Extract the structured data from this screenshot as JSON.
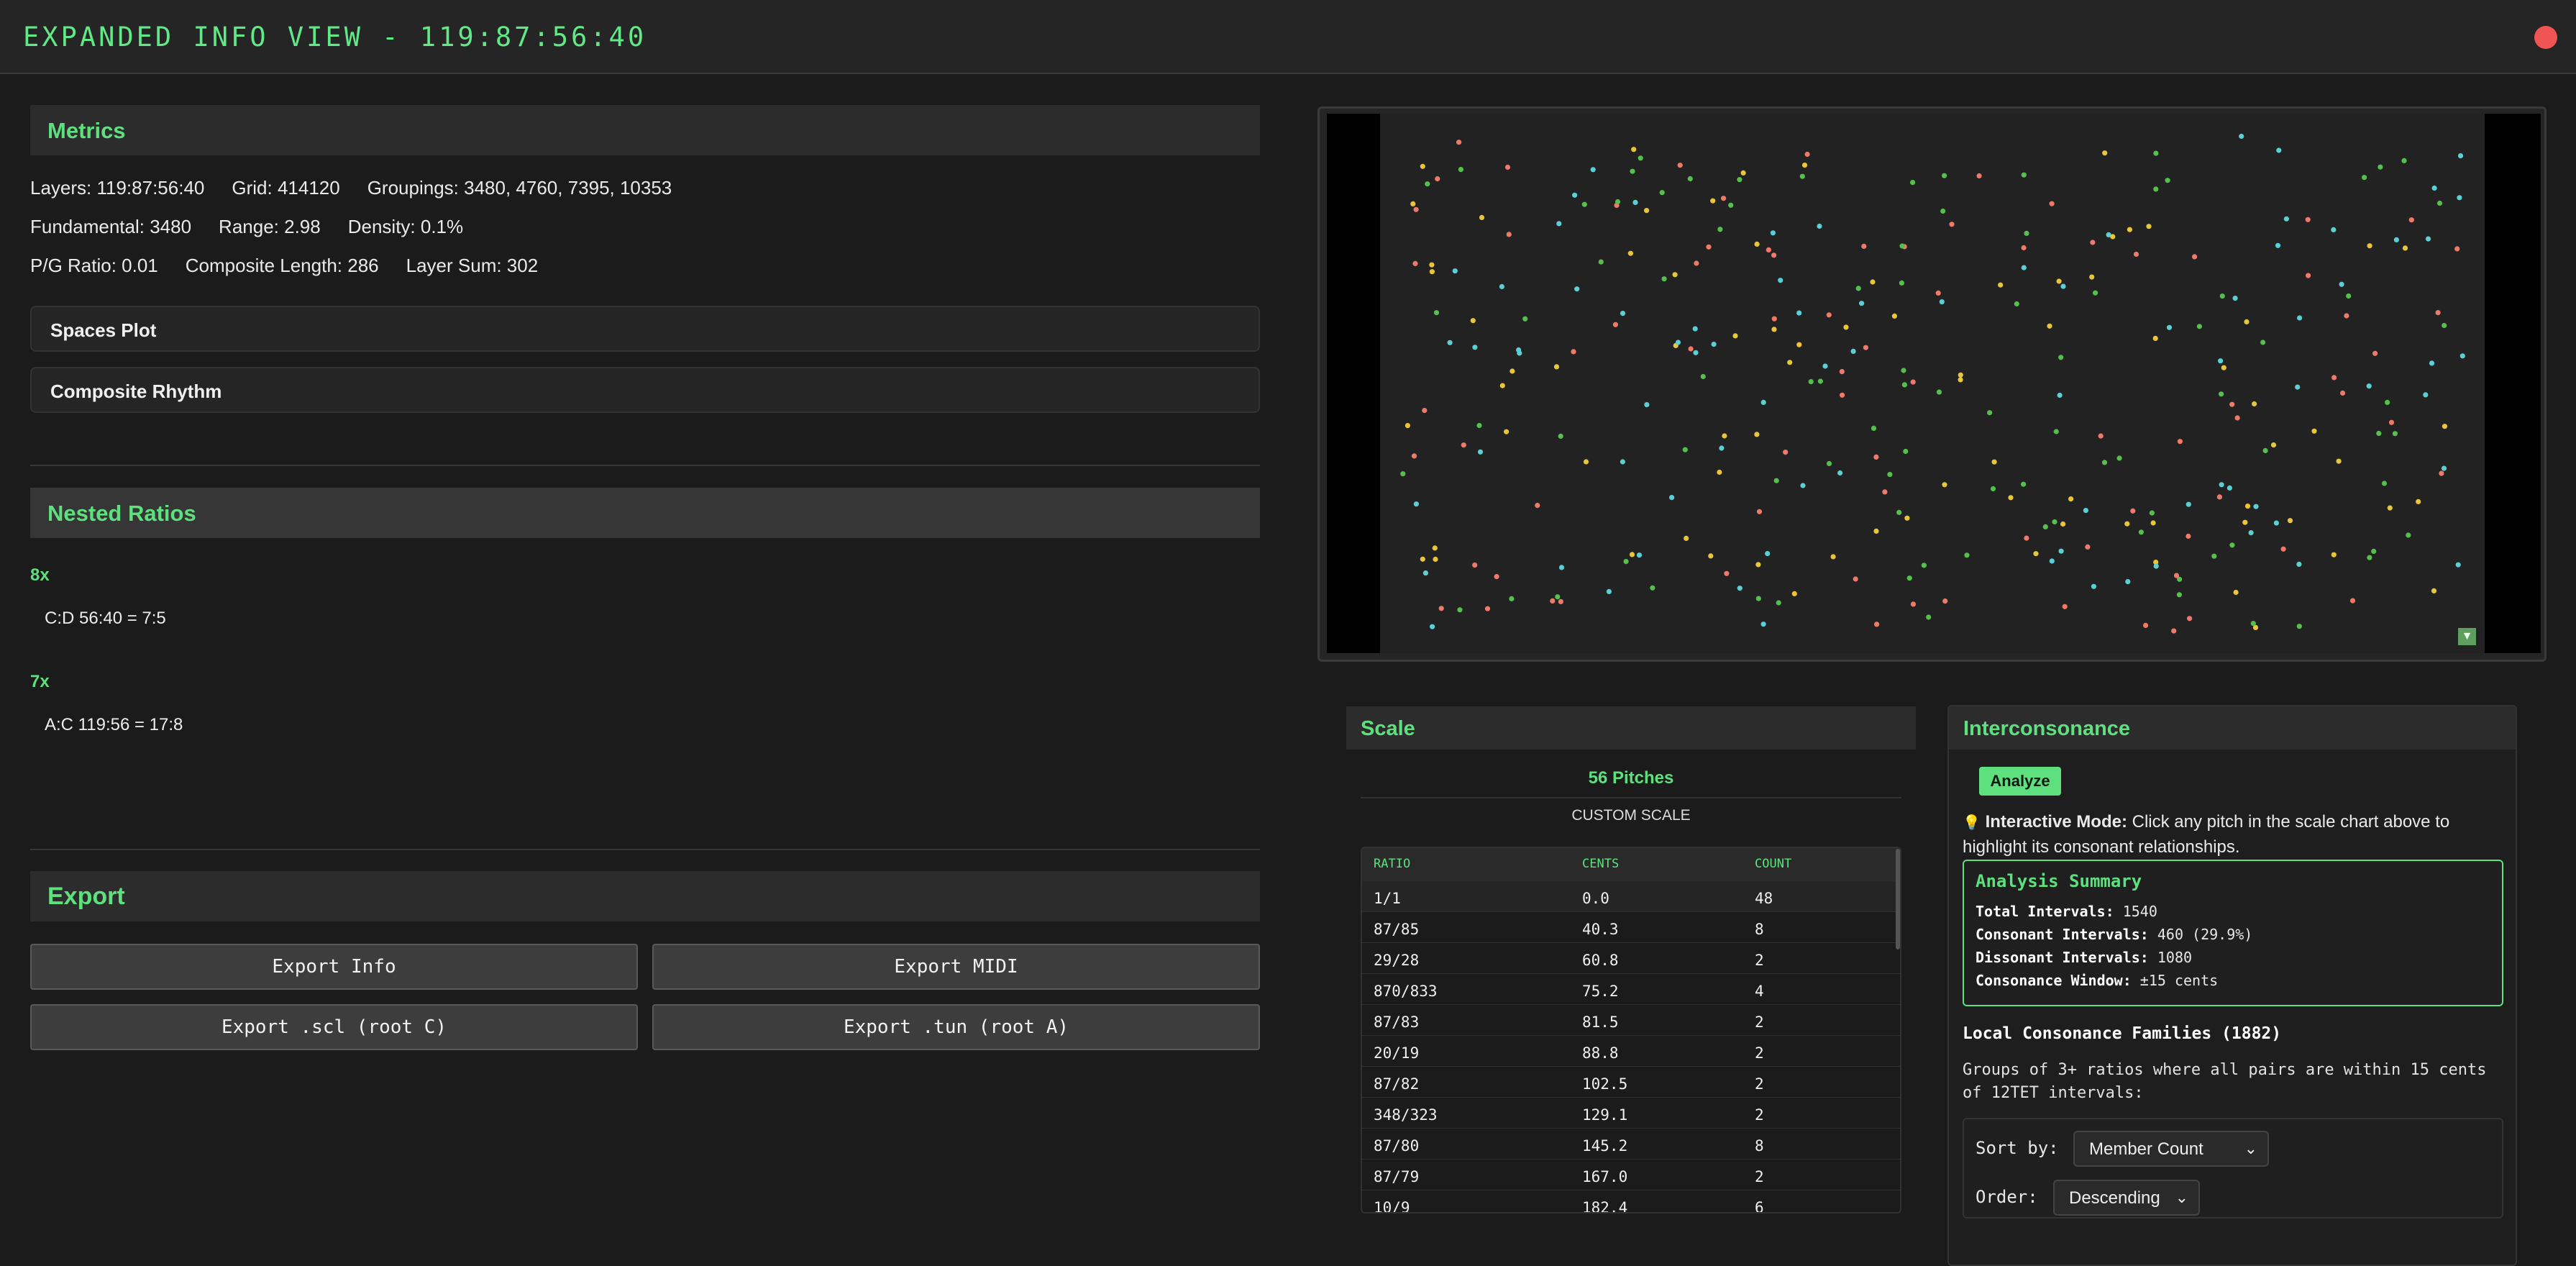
{
  "window": {
    "title": "EXPANDED INFO VIEW - 119:87:56:40"
  },
  "metrics": {
    "header": "Metrics",
    "line1": [
      "Layers: 119:87:56:40",
      "Grid: 414120",
      "Groupings: 3480, 4760, 7395, 10353"
    ],
    "line2": [
      "Fundamental: 3480",
      "Range: 2.98",
      "Density: 0.1%"
    ],
    "line3": [
      "P/G Ratio: 0.01",
      "Composite Length: 286",
      "Layer Sum: 302"
    ],
    "spaces_plot": "Spaces Plot",
    "composite_rhythm": "Composite Rhythm"
  },
  "nested": {
    "header": "Nested Ratios",
    "groups": [
      {
        "label": "8x",
        "line": "C:D 56:40 = 7:5"
      },
      {
        "label": "7x",
        "line": "A:C 119:56 = 17:8"
      }
    ]
  },
  "export": {
    "header": "Export",
    "buttons": [
      "Export Info",
      "Export MIDI",
      "Export .scl (root C)",
      "Export .tun (root A)"
    ]
  },
  "plot": {
    "colors": [
      "#f07a6a",
      "#5ad0d6",
      "#55c04d",
      "#e8c53a"
    ],
    "toggle_glyph": "▼"
  },
  "scale": {
    "header": "Scale",
    "pitch_count": "56 Pitches",
    "scale_name": "CUSTOM SCALE",
    "columns": [
      "RATIO",
      "CENTS",
      "COUNT"
    ],
    "rows": [
      [
        "1/1",
        "0.0",
        "48"
      ],
      [
        "87/85",
        "40.3",
        "8"
      ],
      [
        "29/28",
        "60.8",
        "2"
      ],
      [
        "870/833",
        "75.2",
        "4"
      ],
      [
        "87/83",
        "81.5",
        "2"
      ],
      [
        "20/19",
        "88.8",
        "2"
      ],
      [
        "87/82",
        "102.5",
        "2"
      ],
      [
        "348/323",
        "129.1",
        "2"
      ],
      [
        "87/80",
        "145.2",
        "8"
      ],
      [
        "87/79",
        "167.0",
        "2"
      ],
      [
        "10/9",
        "182.4",
        "6"
      ]
    ]
  },
  "inter": {
    "header": "Interconsonance",
    "analyze": "Analyze",
    "mode_icon": "💡",
    "mode_label": "Interactive Mode:",
    "mode_text": "Click any pitch in the scale chart above to",
    "mode_text2": "highlight its consonant relationships.",
    "summary_title": "Analysis Summary",
    "summary": [
      {
        "k": "Total Intervals:",
        "v": "1540"
      },
      {
        "k": "Consonant Intervals:",
        "v": "460 (29.9%)"
      },
      {
        "k": "Dissonant Intervals:",
        "v": "1080"
      },
      {
        "k": "Consonance Window:",
        "v": "±15 cents"
      }
    ],
    "families_title": "Local Consonance Families (1882)",
    "families_desc1": "Groups of 3+ ratios where all pairs are within 15 cents",
    "families_desc2": "of 12TET intervals:",
    "sort_label": "Sort by:",
    "sort_value": "Member Count",
    "order_label": "Order:",
    "order_value": "Descending"
  }
}
